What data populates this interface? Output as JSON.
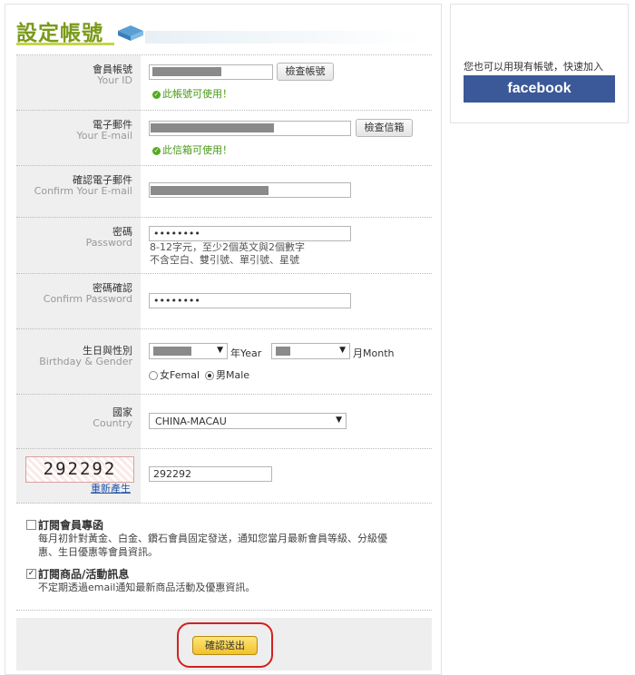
{
  "page": {
    "title": "設定帳號"
  },
  "form": {
    "account": {
      "label_zh": "會員帳號",
      "label_en": "Your ID",
      "check_button": "檢查帳號",
      "status": "此帳號可使用！"
    },
    "email": {
      "label_zh": "電子郵件",
      "label_en": "Your E-mail",
      "check_button": "檢查信箱",
      "status": "此信箱可使用！"
    },
    "confirm_email": {
      "label_zh": "確認電子郵件",
      "label_en": "Confirm Your E-mail"
    },
    "password": {
      "label_zh": "密碼",
      "label_en": "Password",
      "value": "••••••••",
      "hint_line1": "8-12字元，至少2個英文與2個數字",
      "hint_line2": "不含空白、雙引號、單引號、星號"
    },
    "confirm_password": {
      "label_zh": "密碼確認",
      "label_en": "Confirm Password",
      "value": "••••••••"
    },
    "birthday": {
      "label_zh": "生日與性別",
      "label_en": "Birthday & Gender",
      "year_unit": "年Year",
      "month_unit": "月Month",
      "female": "女Femal",
      "male": "男Male",
      "selected_gender": "male"
    },
    "country": {
      "label_zh": "國家",
      "label_en": "Country",
      "value": "CHINA-MACAU"
    },
    "captcha": {
      "code": "292292",
      "regenerate": "重新產生",
      "input_value": "292292"
    }
  },
  "subscriptions": [
    {
      "title": "訂閱會員專函",
      "checked": false,
      "desc_line1": "每月初針對黃金、白金、鑽石會員固定發送，通知您當月最新會員等級、分級優",
      "desc_line2": "惠、生日優惠等會員資訊。"
    },
    {
      "title": "訂閱商品/活動訊息",
      "checked": true,
      "desc_line1": "不定期透過email通知最新商品活動及優惠資訊。",
      "desc_line2": ""
    }
  ],
  "submit": {
    "label": "確認送出"
  },
  "sidebar": {
    "text": "您也可以用現有帳號，快速加入",
    "facebook_label": "facebook"
  },
  "colors": {
    "accent": "#7a9a1a",
    "facebook": "#3b5998",
    "submit": "#f2c12c",
    "highlight_circle": "#d42020"
  }
}
